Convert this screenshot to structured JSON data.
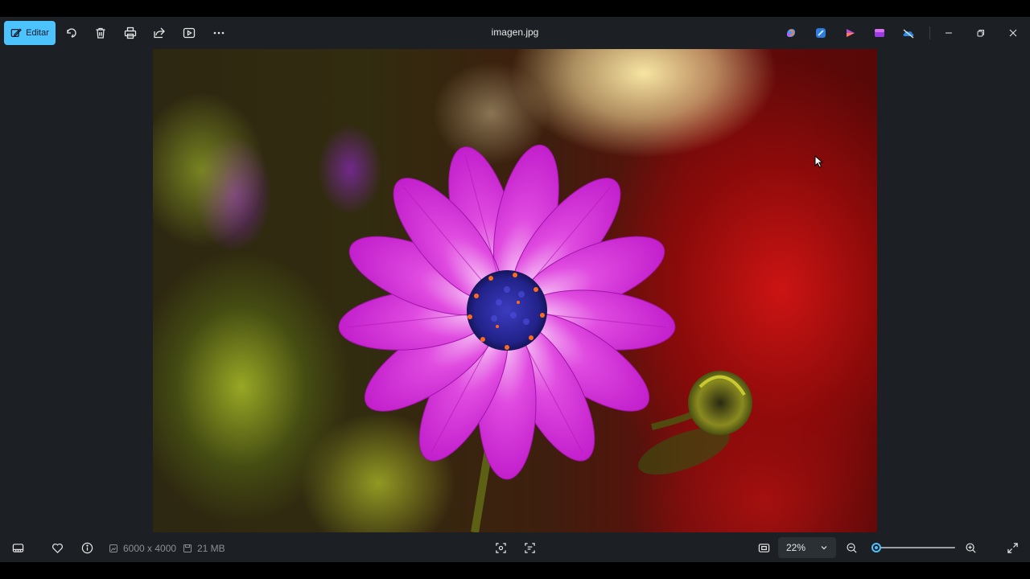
{
  "toolbar": {
    "edit_label": "Editar",
    "title": "imagen.jpg",
    "icons": [
      "rotate-icon",
      "delete-icon",
      "print-icon",
      "share-icon",
      "slideshow-icon",
      "more-icon"
    ],
    "app_icons": [
      "copilot-icon",
      "designer-icon",
      "clipchamp-icon",
      "create-icon",
      "onedrive-icon"
    ],
    "window_controls": [
      "minimize-icon",
      "restore-icon",
      "close-icon"
    ]
  },
  "photo": {
    "subject_colors": {
      "petals": "#d92bd6",
      "center": "#2a2a9a",
      "accent": "#4cc2ff"
    }
  },
  "bottombar": {
    "dimensions": "6000 x 4000",
    "file_size": "21 MB",
    "zoom_value": "22%",
    "zoom_level_fraction": 0.0
  }
}
